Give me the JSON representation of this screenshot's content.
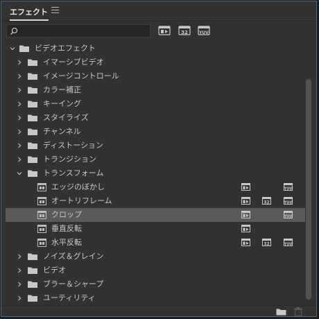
{
  "panel": {
    "title": "エフェクト",
    "search": {
      "value": "",
      "placeholder": ""
    },
    "filter_buttons": [
      {
        "name": "accelerated-effects-filter",
        "glyph": ""
      },
      {
        "name": "32bit-filter",
        "label": "32"
      },
      {
        "name": "yuv-filter",
        "label": "YUV"
      }
    ]
  },
  "tree": {
    "root": {
      "label": "ビデオエフェクト",
      "expanded": true
    },
    "categories": [
      {
        "label": "イマーシブビデオ",
        "expanded": false
      },
      {
        "label": "イメージコントロール",
        "expanded": false
      },
      {
        "label": "カラー補正",
        "expanded": false
      },
      {
        "label": "キーイング",
        "expanded": false
      },
      {
        "label": "スタイライズ",
        "expanded": false
      },
      {
        "label": "チャンネル",
        "expanded": false
      },
      {
        "label": "ディストーション",
        "expanded": false
      },
      {
        "label": "トランジション",
        "expanded": false
      },
      {
        "label": "トランスフォーム",
        "expanded": true
      }
    ],
    "effects": [
      {
        "label": "エッジのぼかし",
        "accelerated": true,
        "bit32": false,
        "yuv": true,
        "selected": false
      },
      {
        "label": "オートリフレーム",
        "accelerated": true,
        "bit32": true,
        "yuv": true,
        "selected": false
      },
      {
        "label": "クロップ",
        "accelerated": true,
        "bit32": false,
        "yuv": true,
        "selected": true
      },
      {
        "label": "垂直反転",
        "accelerated": true,
        "bit32": false,
        "yuv": false,
        "selected": false
      },
      {
        "label": "水平反転",
        "accelerated": true,
        "bit32": true,
        "yuv": true,
        "selected": false
      }
    ],
    "categories_after": [
      {
        "label": "ノイズ＆グレイン",
        "expanded": false
      },
      {
        "label": "ビデオ",
        "expanded": false
      },
      {
        "label": "ブラー＆シャープ",
        "expanded": false
      },
      {
        "label": "ユーティリティ",
        "expanded": false
      }
    ],
    "badge_text": {
      "bit32": "32",
      "yuv": "YUV"
    }
  },
  "colors": {
    "background": "#323232",
    "selected_row": "#5a5a5a",
    "focus_border": "#4a6a86",
    "text": "#c8c8c8"
  },
  "footer": {
    "new_bin": "new-bin-icon",
    "delete": "trash-icon"
  }
}
